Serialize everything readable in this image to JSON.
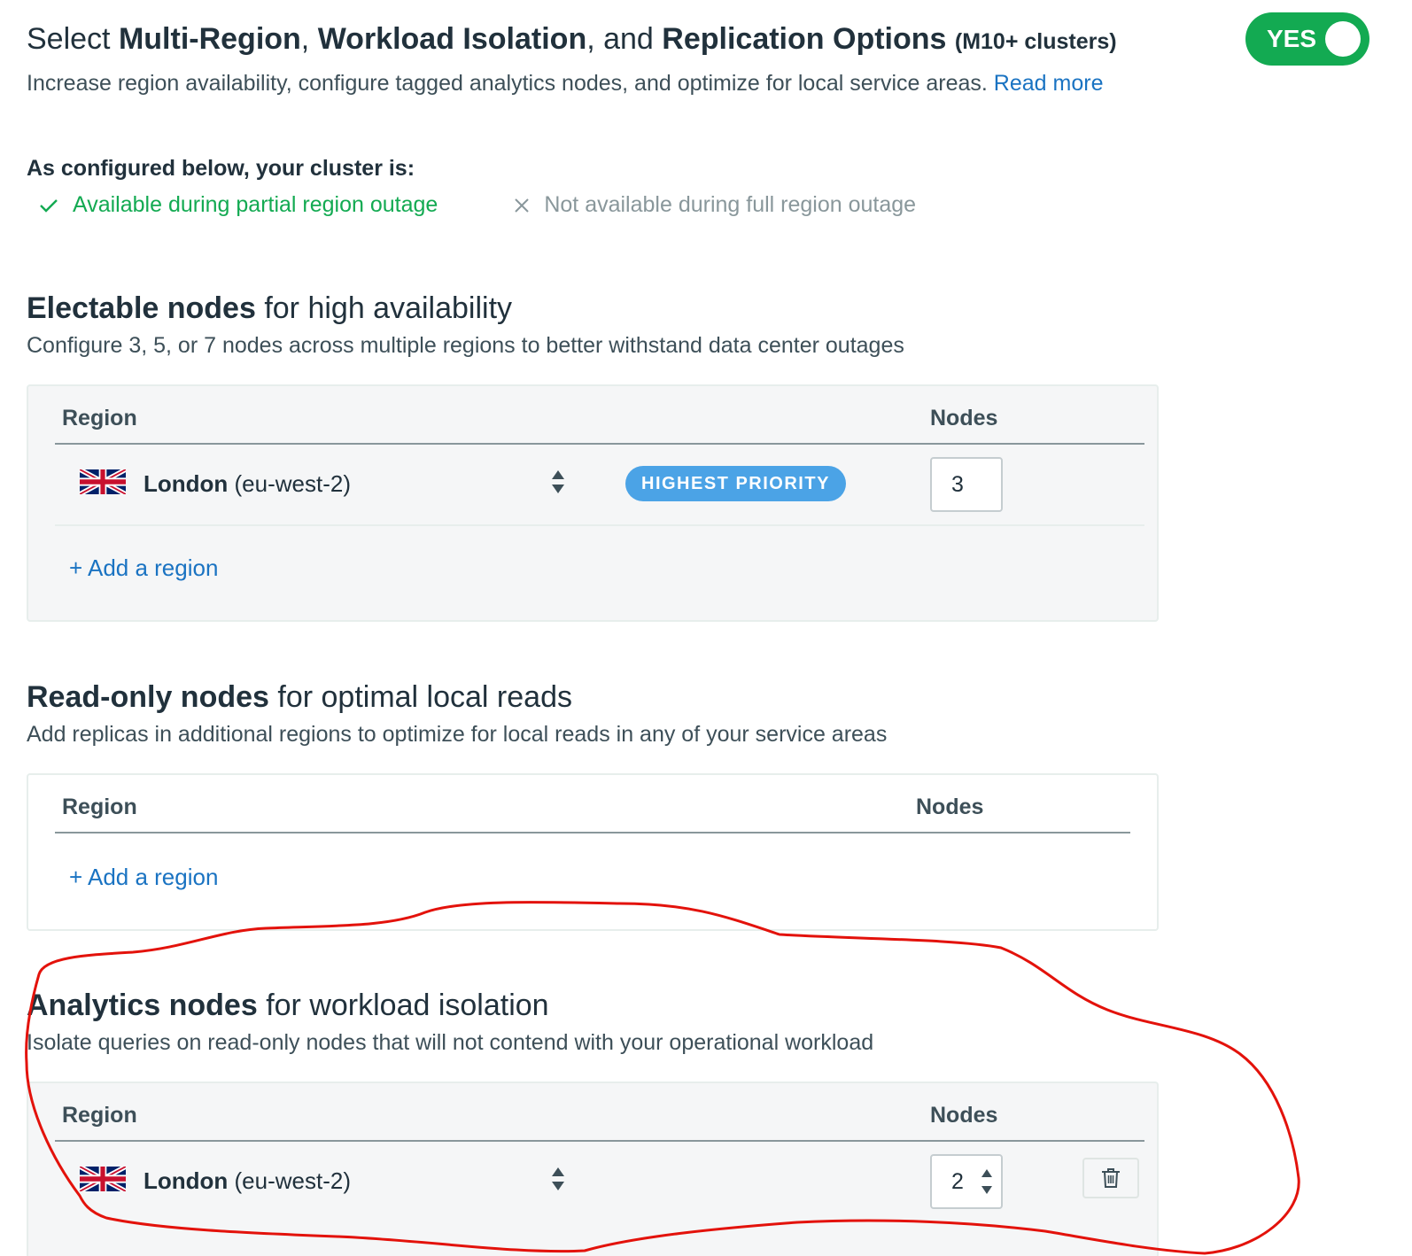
{
  "header": {
    "title_prefix": "Select ",
    "title_part1": "Multi-Region",
    "title_sep1": ", ",
    "title_part2": "Workload Isolation",
    "title_sep2": ", and ",
    "title_part3": "Replication Options",
    "title_suffix": "(M10+ clusters)",
    "description": "Increase region availability, configure tagged analytics nodes, and optimize for local service areas. ",
    "read_more": "Read more"
  },
  "toggle": {
    "label": "YES",
    "state": "on",
    "color": "#13aa52"
  },
  "availability": {
    "title": "As configured below, your cluster is:",
    "ok_text": "Available during partial region outage",
    "no_text": "Not available during full region outage",
    "ok_color": "#13aa52",
    "no_color": "#89979b"
  },
  "electable": {
    "title_bold": "Electable nodes",
    "title_rest": " for high availability",
    "description": "Configure 3, 5, or 7 nodes across multiple regions to better withstand data center outages",
    "col_region": "Region",
    "col_nodes": "Nodes",
    "rows": [
      {
        "flag": "uk-flag-icon",
        "city": "London",
        "code": " (eu-west-2)",
        "badge": "HIGHEST PRIORITY",
        "nodes": "3"
      }
    ],
    "add_label": "+ Add a region"
  },
  "readonly": {
    "title_bold": "Read-only nodes",
    "title_rest": " for optimal local reads",
    "description": "Add replicas in additional regions to optimize for local reads in any of your service areas",
    "col_region": "Region",
    "col_nodes": "Nodes",
    "add_label": "+ Add a region"
  },
  "analytics": {
    "title_bold": "Analytics nodes",
    "title_rest": " for workload isolation",
    "description": "Isolate queries on read-only nodes that will not contend with your operational workload",
    "col_region": "Region",
    "col_nodes": "Nodes",
    "rows": [
      {
        "flag": "uk-flag-icon",
        "city": "London",
        "code": " (eu-west-2)",
        "nodes": "2"
      }
    ]
  },
  "colors": {
    "accent_link": "#1a73c2",
    "badge_blue": "#4ba3e6",
    "annotation_red": "#e3120b"
  }
}
